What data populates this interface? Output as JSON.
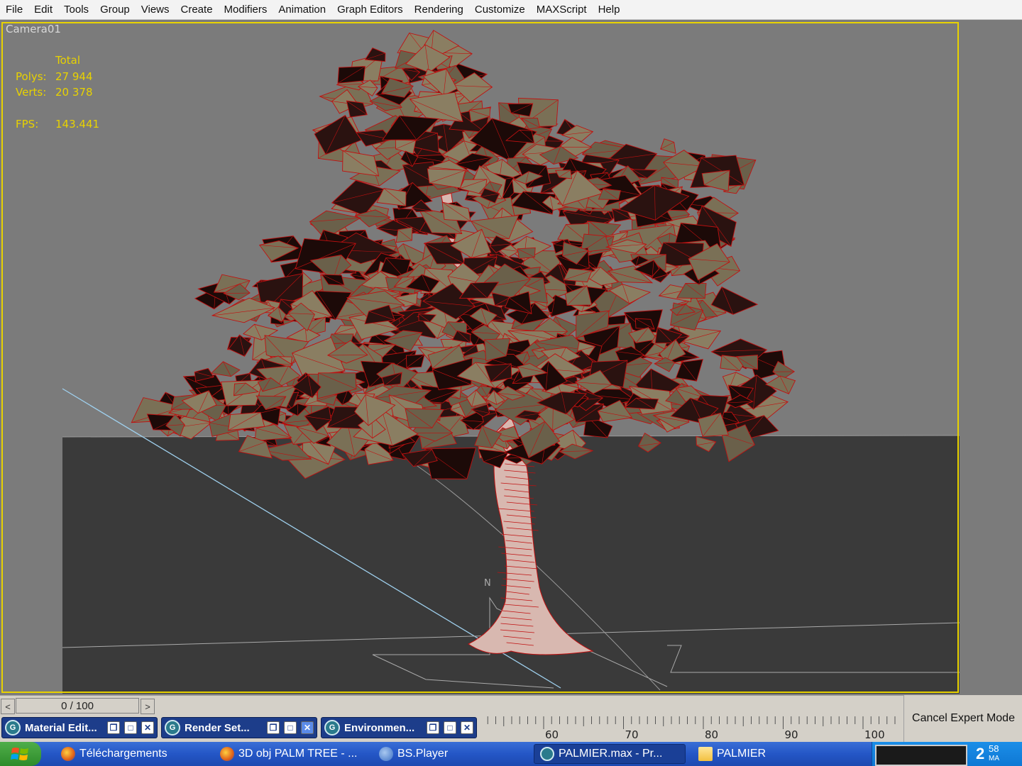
{
  "menubar": {
    "items": [
      "File",
      "Edit",
      "Tools",
      "Group",
      "Views",
      "Create",
      "Modifiers",
      "Animation",
      "Graph Editors",
      "Rendering",
      "Customize",
      "MAXScript",
      "Help"
    ]
  },
  "viewport": {
    "label": "Camera01",
    "stats": {
      "total_label": "Total",
      "polys_label": "Polys:",
      "polys_value": "27 944",
      "verts_label": "Verts:",
      "verts_value": "20 378",
      "fps_label": "FPS:",
      "fps_value": "143.441"
    },
    "compass_label": "N",
    "colors": {
      "background": "#7b7b7b",
      "ground": "#3a3a3a",
      "frame": "#e8d200",
      "wire": "#c01010",
      "leaf": "#7a7056",
      "trunk": "#d8b8b0"
    }
  },
  "timeline": {
    "prev": "<",
    "next": ">",
    "frame_display": "0 / 100"
  },
  "ruler": {
    "labels": [
      "60",
      "70",
      "80",
      "90",
      "100"
    ]
  },
  "expert_mode": {
    "label": "Cancel Expert Mode"
  },
  "floating_windows": [
    {
      "title": "Material Edit...",
      "icon": "3dsmax-icon"
    },
    {
      "title": "Render Set...",
      "icon": "3dsmax-icon"
    },
    {
      "title": "Environmen...",
      "icon": "3dsmax-icon"
    }
  ],
  "taskbar": {
    "items": [
      {
        "label": "Téléchargements",
        "icon": "firefox-icon"
      },
      {
        "label": "3D obj PALM TREE - ...",
        "icon": "firefox-icon"
      },
      {
        "label": "BS.Player",
        "icon": "bsplayer-icon"
      },
      {
        "label": "PALMIER.max     - Pr...",
        "icon": "3dsmax-icon"
      },
      {
        "label": "PALMIER",
        "icon": "folder-icon"
      }
    ],
    "clock": {
      "hour": "2",
      "minute": "58",
      "suffix": "MA"
    }
  }
}
